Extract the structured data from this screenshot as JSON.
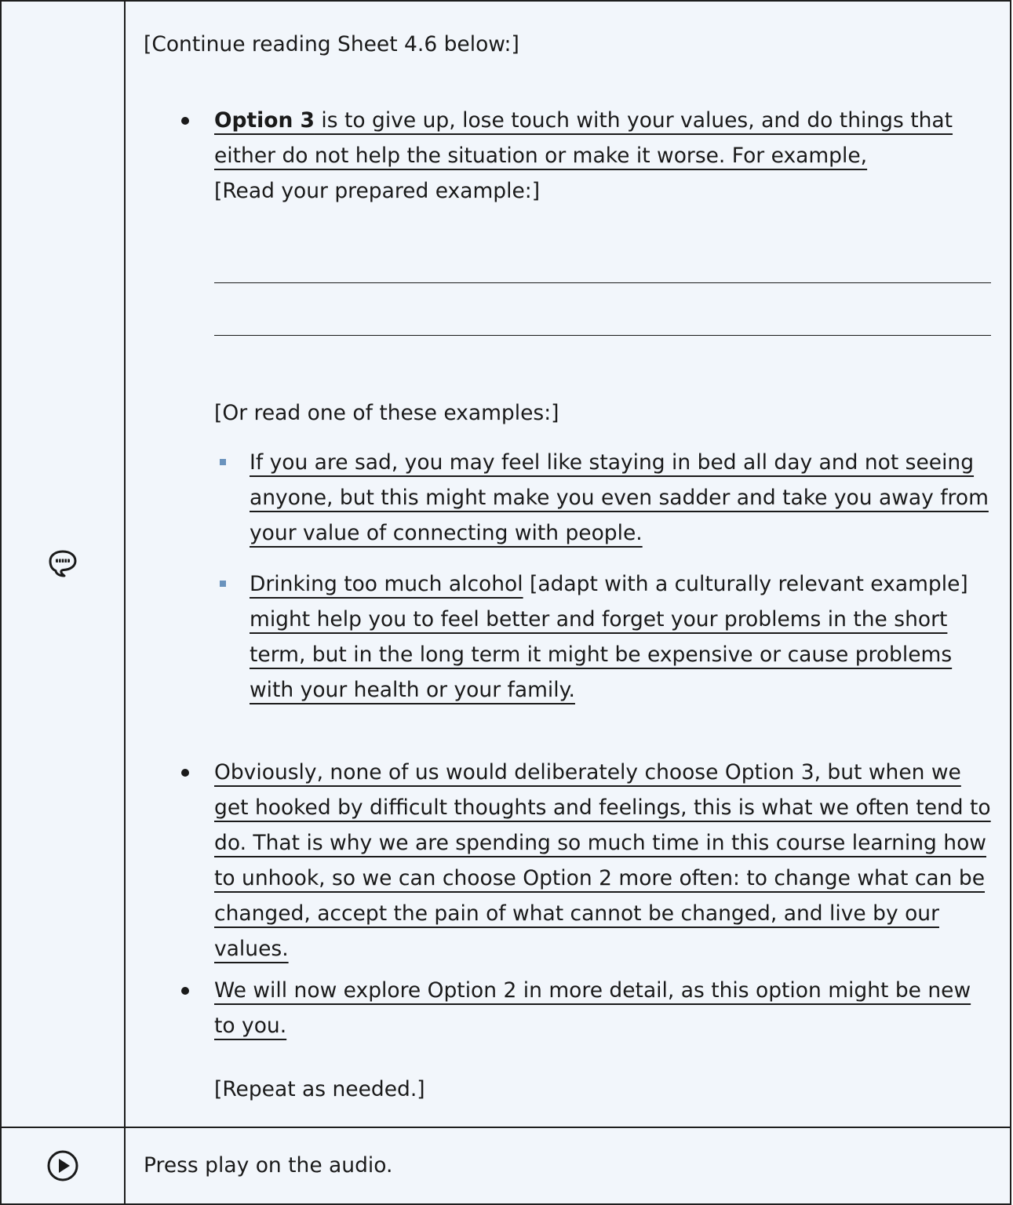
{
  "main": {
    "icon": "speech-bubble-icon",
    "intro": "[Continue reading Sheet 4.6 below:]",
    "option3": {
      "label": "Option 3",
      "text": " is to give up, lose touch with your values, and do things that either do not help the situation or make it worse. For example,",
      "instruction": "[Read your prepared example:]"
    },
    "or_read": "[Or read one of these examples:]",
    "examples": [
      {
        "text": "If you are sad, you may feel like staying in bed all day and not seeing anyone, but this might make you even sadder and take you away from your value of connecting with people."
      },
      {
        "lead": "Drinking too much alcohol",
        "note": " [adapt with a culturally relevant example] ",
        "rest": "might help you to feel better and forget your problems in the short term, but in the long term it might be expensive or cause problems with your health or your family."
      }
    ],
    "bullet2": "Obviously, none of us would deliberately choose Option 3, but when we get hooked by difficult thoughts and feelings, this is what we often tend to do. That is why we are spending so much time in this course learning how to unhook, so we can choose Option 2 more often: to change what can be changed, accept the pain of what cannot be changed, and live by our values.",
    "bullet3": "We will now explore Option 2 in more detail, as this option might be new to you.",
    "repeat": "[Repeat as needed.]"
  },
  "audio": {
    "icon": "play-circle-icon",
    "text": "Press play on the audio."
  }
}
